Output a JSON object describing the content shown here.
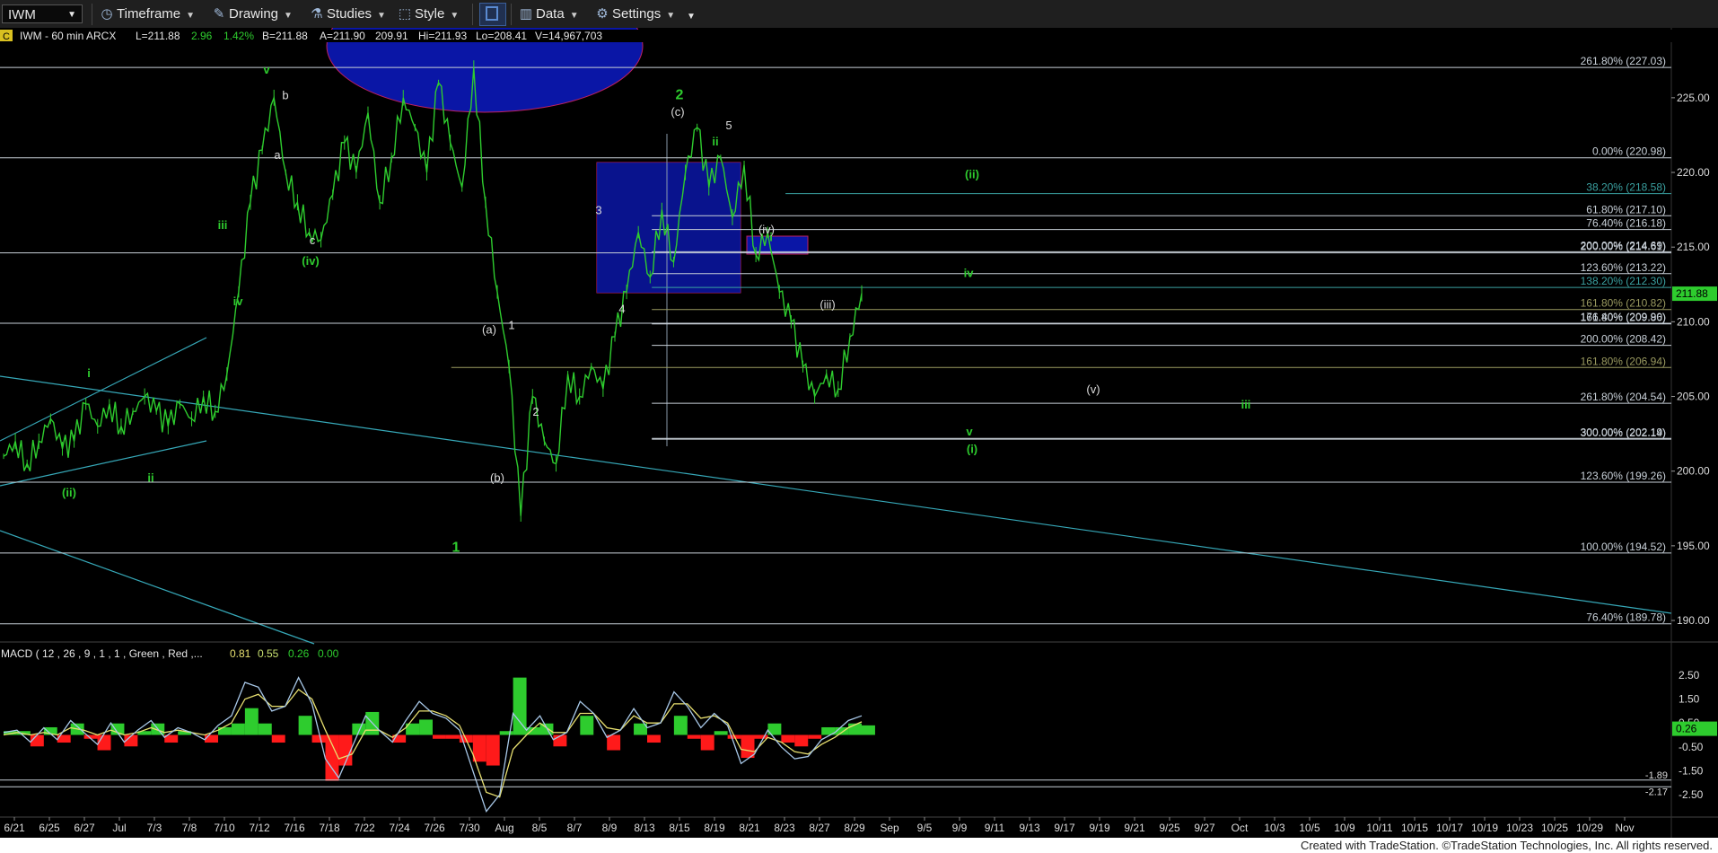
{
  "toolbar": {
    "symbol": "IWM",
    "timeframe": "Timeframe",
    "drawing": "Drawing",
    "studies": "Studies",
    "style": "Style",
    "data": "Data",
    "settings": "Settings"
  },
  "header": {
    "badge": "C",
    "symbol_text": "IWM - 60 min  ARCX",
    "last": "L=211.88",
    "change": "2.96",
    "pct": "1.42%",
    "bid": "B=211.88",
    "ask": "A=211.90",
    "extra": "209.91",
    "high": "Hi=211.93",
    "low": "Lo=208.41",
    "volume": "V=14,967,703"
  },
  "colors": {
    "bull": "#2ecc2e",
    "bear": "#ff1a1a",
    "fib_line": "#c8d0d8",
    "trend": "#36a8b8",
    "box": "#0a16a6",
    "box_border": "#c02060"
  },
  "chart_data": [
    {
      "type": "line",
      "title": "IWM - 60 min",
      "ylim": [
        188.8,
        229.2
      ],
      "y_ticks": [
        "225.00",
        "220.00",
        "215.00",
        "210.00",
        "205.00",
        "200.00",
        "195.00",
        "190.00"
      ],
      "last_price": "211.88",
      "x_ticks": [
        "6/21",
        "6/25",
        "6/27",
        "Jul",
        "7/3",
        "7/8",
        "7/10",
        "7/12",
        "7/16",
        "7/18",
        "7/22",
        "7/24",
        "7/26",
        "7/30",
        "Aug",
        "8/5",
        "8/7",
        "8/9",
        "8/13",
        "8/15",
        "8/19",
        "8/21",
        "8/23",
        "8/27",
        "8/29",
        "Sep",
        "9/5",
        "9/9",
        "9/11",
        "9/13",
        "9/17",
        "9/19",
        "9/21",
        "9/25",
        "9/27",
        "Oct",
        "10/3",
        "10/5",
        "10/9",
        "10/11",
        "10/15",
        "10/17",
        "10/19",
        "10/23",
        "10/25",
        "10/29",
        "Nov"
      ],
      "series": [
        {
          "values": [
            201,
            202,
            200.5,
            202,
            203.5,
            201.5,
            202,
            204.5,
            203,
            204.5,
            203,
            204,
            205,
            204,
            203,
            204.5,
            203.5,
            205,
            204,
            206.5,
            212,
            218,
            221.5,
            225,
            220,
            218,
            216,
            215.5,
            218.5,
            222,
            220,
            224,
            218,
            221,
            225,
            223,
            220,
            226,
            222,
            219,
            227,
            218,
            212,
            207,
            197,
            205,
            202,
            200.5,
            206.5,
            205,
            207,
            205.5,
            209,
            212,
            216,
            213,
            217.5,
            214,
            220,
            223,
            219,
            221,
            217,
            220.5,
            214.5,
            216,
            212,
            210,
            207,
            205,
            206.5,
            205.5,
            209,
            211.9
          ]
        }
      ],
      "fib_levels": [
        {
          "label": "261.80% (227.03)",
          "y": 227.03,
          "x0": 0
        },
        {
          "label": "0.00% (220.98)",
          "y": 220.98,
          "x0": 0
        },
        {
          "label": "38.20% (218.58)",
          "y": 218.58,
          "x0": 0.47
        },
        {
          "label": "61.80% (217.10)",
          "y": 217.1,
          "x0": 0.39
        },
        {
          "label": "76.40% (216.18)",
          "y": 216.18,
          "x0": 0.39
        },
        {
          "label": "200.00% (214.69)",
          "y": 214.69,
          "x0": 0.39
        },
        {
          "label": "200.00% (214.61)",
          "y": 214.61,
          "x0": 0
        },
        {
          "label": "123.60% (213.22)",
          "y": 213.22,
          "x0": 0.39
        },
        {
          "label": "138.20% (212.30)",
          "y": 212.3,
          "x0": 0.39
        },
        {
          "label": "161.80% (210.82)",
          "y": 210.82,
          "x0": 0.39
        },
        {
          "label": "176.40% (209.90)",
          "y": 209.9,
          "x0": 0
        },
        {
          "label": "161.80% (209.86)",
          "y": 209.86,
          "x0": 0.39
        },
        {
          "label": "200.00% (208.42)",
          "y": 208.42,
          "x0": 0.39
        },
        {
          "label": "161.80% (206.94)",
          "y": 206.94,
          "x0": 0.27
        },
        {
          "label": "261.80% (204.54)",
          "y": 204.54,
          "x0": 0.39
        },
        {
          "label": "300.00% (202.14)",
          "y": 202.14,
          "x0": 0.39
        },
        {
          "label": "300.00% (202.19)",
          "y": 202.19,
          "x0": 0.39
        },
        {
          "label": "123.60% (199.26)",
          "y": 199.26,
          "x0": 0
        },
        {
          "label": "100.00% (194.52)",
          "y": 194.52,
          "x0": 0
        },
        {
          "label": "76.40% (189.78)",
          "y": 189.78,
          "x0": 0
        }
      ],
      "wave_labels": [
        {
          "text": "v",
          "y": 226.6,
          "color": "green"
        },
        {
          "text": "b",
          "y": 224.9,
          "color": "white"
        },
        {
          "text": "a",
          "y": 220.9,
          "color": "white"
        },
        {
          "text": "c",
          "y": 215.2,
          "color": "white"
        },
        {
          "text": "(iv)",
          "y": 213.8,
          "color": "green"
        },
        {
          "text": "iii",
          "y": 216.2,
          "color": "green"
        },
        {
          "text": "iv",
          "y": 211.1,
          "color": "green"
        },
        {
          "text": "i",
          "y": 206.3,
          "color": "green"
        },
        {
          "text": "(ii)",
          "y": 198.3,
          "color": "green"
        },
        {
          "text": "ii",
          "y": 199.3,
          "color": "green"
        },
        {
          "text": "(v)",
          "y": 229,
          "color": "white"
        },
        {
          "text": "(a)",
          "y": 209.2,
          "color": "white"
        },
        {
          "text": "1",
          "y": 209.5,
          "color": "white"
        },
        {
          "text": "(b)",
          "y": 199.3,
          "color": "white"
        },
        {
          "text": "2",
          "y": 203.7,
          "color": "white"
        },
        {
          "text": "1",
          "y": 194.6,
          "color": "green"
        },
        {
          "text": "3",
          "y": 217.2,
          "color": "white"
        },
        {
          "text": "4",
          "y": 210.6,
          "color": "white"
        },
        {
          "text": "2",
          "y": 224.9,
          "color": "green"
        },
        {
          "text": "(c)",
          "y": 223.8,
          "color": "white"
        },
        {
          "text": "5",
          "y": 222.9,
          "color": "white"
        },
        {
          "text": "ii",
          "y": 221.8,
          "color": "green"
        },
        {
          "text": "i",
          "y": 215.4,
          "color": "green"
        },
        {
          "text": "(iv)",
          "y": 215.9,
          "color": "white"
        },
        {
          "text": "(iii)",
          "y": 210.9,
          "color": "white"
        },
        {
          "text": "(v)",
          "y": 205.2,
          "color": "white"
        },
        {
          "text": "iii",
          "y": 204.2,
          "color": "green"
        },
        {
          "text": "iv",
          "y": 213.0,
          "color": "green"
        },
        {
          "text": "(ii)",
          "y": 219.6,
          "color": "green"
        },
        {
          "text": "v",
          "y": 202.4,
          "color": "green"
        },
        {
          "text": "(i)",
          "y": 201.2,
          "color": "green"
        }
      ]
    },
    {
      "type": "line",
      "title": "MACD ( 12 , 26 , 9 , 1 , 1 , Green , Red ,...",
      "readout": [
        "0.81",
        "0.55",
        "0.26",
        "0.00"
      ],
      "ylim": [
        -3.1,
        3.1
      ],
      "y_ticks": [
        "2.50",
        "1.50",
        "0.50",
        "-0.50",
        "-1.50",
        "-2.50"
      ],
      "level_labels": [
        "-1.89",
        "-2.17"
      ],
      "last_value": "0.26",
      "series": [
        {
          "name": "MACD",
          "values": [
            0.1,
            0.2,
            -0.3,
            0.3,
            -0.2,
            0.6,
            0.1,
            -0.4,
            0.5,
            -0.3,
            0.2,
            0.6,
            -0.1,
            0.3,
            0.1,
            -0.2,
            0.4,
            0.8,
            2.2,
            2.0,
            1.0,
            1.2,
            2.4,
            1.3,
            -1.0,
            -1.8,
            -0.5,
            0.8,
            0.2,
            -0.3,
            0.6,
            1.4,
            0.9,
            0.7,
            0.2,
            -1.5,
            -3.2,
            -2.5,
            0.9,
            0.2,
            0.8,
            -0.2,
            0.1,
            1.4,
            0.9,
            -0.1,
            0.2,
            1.1,
            0.3,
            0.5,
            1.8,
            1.2,
            0.3,
            0.9,
            0.4,
            -1.2,
            -0.8,
            0.2,
            -0.5,
            -1.0,
            -0.9,
            -0.2,
            0.1,
            0.6,
            0.8
          ]
        },
        {
          "name": "Signal",
          "values": [
            0.0,
            0.1,
            0.0,
            0.1,
            0.0,
            0.3,
            0.2,
            0.0,
            0.2,
            0.0,
            0.1,
            0.3,
            0.1,
            0.2,
            0.1,
            0.0,
            0.2,
            0.5,
            1.5,
            1.7,
            1.2,
            1.2,
            1.9,
            1.5,
            0.2,
            -1.0,
            -0.8,
            0.2,
            0.2,
            -0.1,
            0.3,
            1.0,
            1.0,
            0.8,
            0.4,
            -0.8,
            -2.4,
            -2.6,
            -0.6,
            0.0,
            0.5,
            0.1,
            0.1,
            0.9,
            0.9,
            0.3,
            0.2,
            0.8,
            0.5,
            0.5,
            1.3,
            1.3,
            0.7,
            0.8,
            0.5,
            -0.6,
            -0.7,
            -0.1,
            -0.3,
            -0.7,
            -0.8,
            -0.4,
            -0.1,
            0.3,
            0.55
          ]
        }
      ]
    }
  ],
  "footer": {
    "text": "Created with TradeStation. ©TradeStation Technologies, Inc. All rights reserved."
  }
}
